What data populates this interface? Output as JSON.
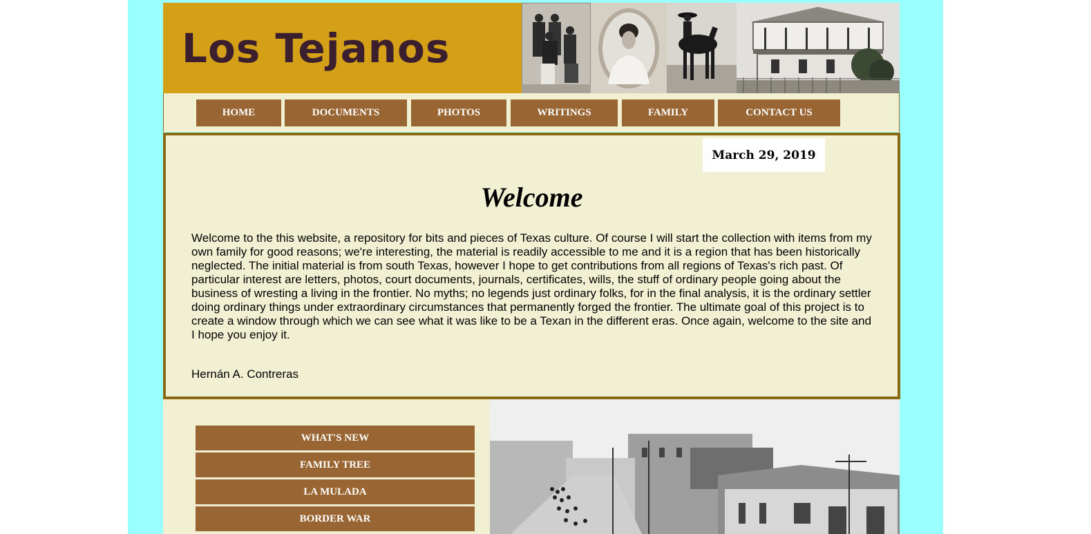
{
  "site": {
    "title": "Los Tejanos"
  },
  "nav": {
    "items": [
      {
        "label": "HOME"
      },
      {
        "label": "DOCUMENTS"
      },
      {
        "label": "PHOTOS"
      },
      {
        "label": "WRITINGS"
      },
      {
        "label": "FAMILY"
      },
      {
        "label": "CONTACT US"
      }
    ]
  },
  "main": {
    "date": "March 29, 2019",
    "heading": "Welcome",
    "body": "Welcome to the this website, a repository for bits and pieces of Texas culture. Of course I will start the collection with items from my own family for good reasons; we're interesting, the material is readily accessible to me and it is a region that has been historically neglected. The initial material is from south Texas, however I hope to get contributions from all regions of Texas's rich past. Of particular interest are letters, photos, court documents, journals, certificates, wills, the stuff of ordinary people going about the business of wresting a living in the frontier. No myths; no legends just ordinary folks, for in the final analysis, it is the ordinary settler doing ordinary things under extraordinary circumstances that permanently forged the frontier. The ultimate goal of this project is to create a window through which we can see what it was like to be a Texan in the different eras. Once again, welcome to the site and I hope you enjoy it.",
    "signature": "Hernán A. Contreras"
  },
  "sidebar": {
    "items": [
      {
        "label": "WHAT'S NEW"
      },
      {
        "label": "FAMILY TREE"
      },
      {
        "label": "LA MULADA"
      },
      {
        "label": "BORDER WAR"
      }
    ]
  },
  "colors": {
    "page_background": "#99ffff",
    "banner_gold": "#d4a017",
    "title_color": "#3b1f2f",
    "button_brown": "#996633",
    "panel_cream": "#f2f0d2",
    "border_brown": "#8b6914"
  }
}
